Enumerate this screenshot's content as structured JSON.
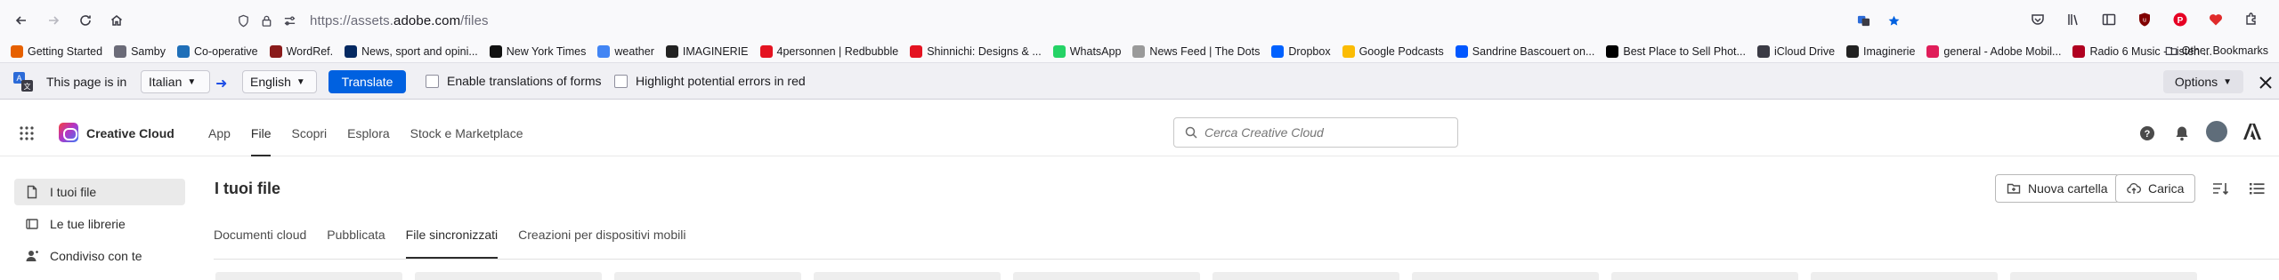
{
  "browser": {
    "url_prefix": "https://assets.",
    "url_domain": "adobe.com",
    "url_path": "/files"
  },
  "bookmarks": [
    {
      "label": "Getting Started",
      "color": "#e66000",
      "icon": "firefox-icon"
    },
    {
      "label": "Samby",
      "color": "#6b6b78",
      "icon": "folder-icon"
    },
    {
      "label": "Co-operative",
      "color": "#1f6fb8",
      "icon": "coop-icon"
    },
    {
      "label": "WordRef.",
      "color": "#8a1b1b",
      "icon": "wr-icon"
    },
    {
      "label": "News, sport and opini...",
      "color": "#052962",
      "icon": "guardian-icon"
    },
    {
      "label": "New York Times",
      "color": "#111111",
      "icon": "nyt-icon"
    },
    {
      "label": "weather",
      "color": "#4285f4",
      "icon": "google-icon"
    },
    {
      "label": "IMAGINERIE",
      "color": "#222222",
      "icon": "imaginerie-icon"
    },
    {
      "label": "4personnen | Redbubble",
      "color": "#e41321",
      "icon": "redbubble-icon"
    },
    {
      "label": "Shinnichi: Designs & ...",
      "color": "#e41321",
      "icon": "redbubble-icon"
    },
    {
      "label": "WhatsApp",
      "color": "#25d366",
      "icon": "whatsapp-icon"
    },
    {
      "label": "News Feed | The Dots",
      "color": "#9a9a9a",
      "icon": "globe-icon"
    },
    {
      "label": "Dropbox",
      "color": "#0061ff",
      "icon": "dropbox-icon"
    },
    {
      "label": "Google Podcasts",
      "color": "#fbbc04",
      "icon": "podcasts-icon"
    },
    {
      "label": "Sandrine Bascouert on...",
      "color": "#0057ff",
      "icon": "behance-icon"
    },
    {
      "label": "Best Place to Sell Phot...",
      "color": "#000000",
      "icon": "stock-icon"
    },
    {
      "label": "iCloud Drive",
      "color": "#3b3b45",
      "icon": "apple-icon"
    },
    {
      "label": "Imaginerie",
      "color": "#222222",
      "icon": "imaginerie-icon"
    },
    {
      "label": "general - Adobe Mobil...",
      "color": "#e01e5a",
      "icon": "slack-icon"
    },
    {
      "label": "Radio 6 Music - Listen ...",
      "color": "#b00020",
      "icon": "bbc-icon"
    }
  ],
  "bookmarks_other": "Other Bookmarks",
  "translation": {
    "label": "This page is in",
    "from_lang": "Italian",
    "to_lang": "English",
    "translate_button": "Translate",
    "option_forms": "Enable translations of forms",
    "option_errors": "Highlight potential errors in red",
    "options_button": "Options",
    "accent": "#0061e0"
  },
  "cc": {
    "brand": "Creative Cloud",
    "nav": [
      "App",
      "File",
      "Scopri",
      "Esplora",
      "Stock e Marketplace"
    ],
    "active_nav": "File",
    "search_placeholder": "Cerca Creative Cloud"
  },
  "sidebar": {
    "items": [
      {
        "label": "I tuoi file",
        "icon": "file-icon",
        "active": true
      },
      {
        "label": "Le tue librerie",
        "icon": "library-icon",
        "active": false
      },
      {
        "label": "Condiviso con te",
        "icon": "shared-user-icon",
        "active": false
      }
    ]
  },
  "main": {
    "title": "I tuoi file",
    "new_folder": "Nuova cartella",
    "upload": "Carica",
    "tabs": [
      "Documenti cloud",
      "Pubblicata",
      "File sincronizzati",
      "Creazioni per dispositivi mobili"
    ],
    "active_tab": "File sincronizzati"
  }
}
